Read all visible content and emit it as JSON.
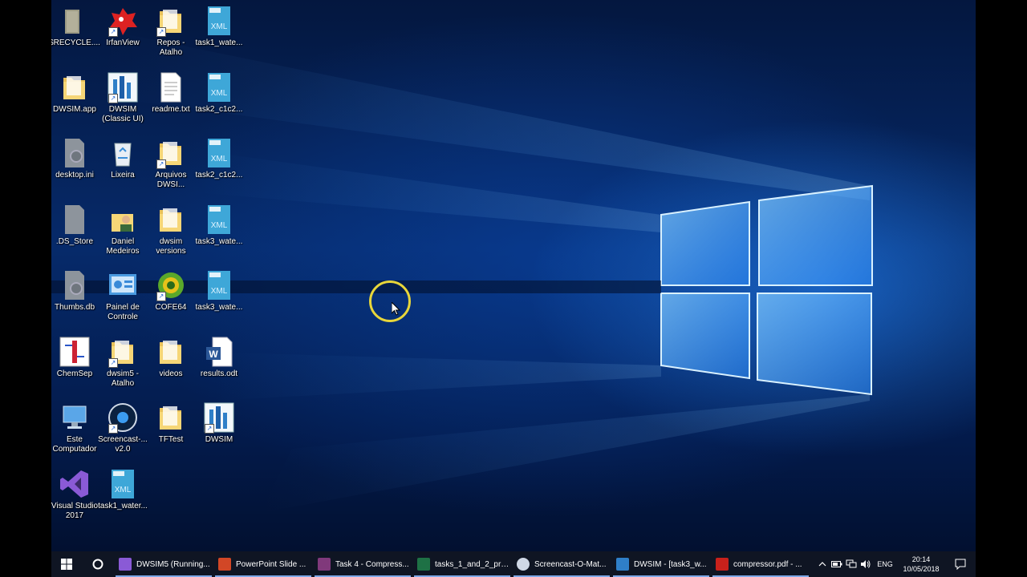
{
  "desktop": {
    "icons": [
      {
        "label": "$RECYCLE....",
        "icon": "gray-folder-icon"
      },
      {
        "label": "IrfanView",
        "icon": "irfanview-icon"
      },
      {
        "label": "Repos - Atalho",
        "icon": "folder-shortcut-icon"
      },
      {
        "label": "task1_wate...",
        "icon": "xml-file-icon"
      },
      {
        "label": "DWSIM.app",
        "icon": "folder-icon"
      },
      {
        "label": "DWSIM (Classic UI)",
        "icon": "dwsim-icon"
      },
      {
        "label": "readme.txt",
        "icon": "text-file-icon"
      },
      {
        "label": "task2_c1c2...",
        "icon": "xml-file-icon"
      },
      {
        "label": "desktop.ini",
        "icon": "settings-file-icon"
      },
      {
        "label": "Lixeira",
        "icon": "recycle-bin-icon"
      },
      {
        "label": "Arquivos DWSI...",
        "icon": "folder-shortcut-icon"
      },
      {
        "label": "task2_c1c2...",
        "icon": "xml-file-icon"
      },
      {
        "label": ".DS_Store",
        "icon": "blank-file-icon"
      },
      {
        "label": "Daniel Medeiros",
        "icon": "user-folder-icon"
      },
      {
        "label": "dwsim versions",
        "icon": "folder-icon"
      },
      {
        "label": "task3_wate...",
        "icon": "xml-file-icon"
      },
      {
        "label": "Thumbs.db",
        "icon": "settings-file-icon"
      },
      {
        "label": "Painel de Controle",
        "icon": "control-panel-icon"
      },
      {
        "label": "COFE64",
        "icon": "cofe-icon"
      },
      {
        "label": "task3_wate...",
        "icon": "xml-file-icon"
      },
      {
        "label": "ChemSep",
        "icon": "chemsep-icon"
      },
      {
        "label": "dwsim5 - Atalho",
        "icon": "folder-shortcut-icon"
      },
      {
        "label": "videos",
        "icon": "folder-icon"
      },
      {
        "label": "results.odt",
        "icon": "word-document-icon"
      },
      {
        "label": "Este Computador",
        "icon": "computer-icon"
      },
      {
        "label": "Screencast-... v2.0",
        "icon": "screencast-icon"
      },
      {
        "label": "TFTest",
        "icon": "folder-icon"
      },
      {
        "label": "DWSIM",
        "icon": "dwsim-icon"
      },
      {
        "label": "Visual Studio 2017",
        "icon": "visual-studio-icon"
      },
      {
        "label": "task1_water...",
        "icon": "xml-file-icon"
      }
    ]
  },
  "taskbar": {
    "tasks": [
      {
        "label": "DWSIM5 (Running...",
        "icon": "visual-studio-icon",
        "color": "#8a5ad6"
      },
      {
        "label": "PowerPoint Slide ...",
        "icon": "powerpoint-icon",
        "color": "#d24726"
      },
      {
        "label": "Task 4 - Compress...",
        "icon": "onenote-icon",
        "color": "#80397b"
      },
      {
        "label": "tasks_1_and_2_pro...",
        "icon": "excel-icon",
        "color": "#1e7145"
      },
      {
        "label": "Screencast-O-Mat...",
        "icon": "screencast-icon",
        "color": "#cfd8e6"
      },
      {
        "label": "DWSIM - [task3_w...",
        "icon": "dwsim-icon",
        "color": "#2f7fc8"
      },
      {
        "label": "compressor.pdf - ...",
        "icon": "pdf-icon",
        "color": "#c8211b"
      }
    ],
    "tray": {
      "language": "ENG",
      "time": "20:14",
      "date": "10/05/2018"
    }
  }
}
